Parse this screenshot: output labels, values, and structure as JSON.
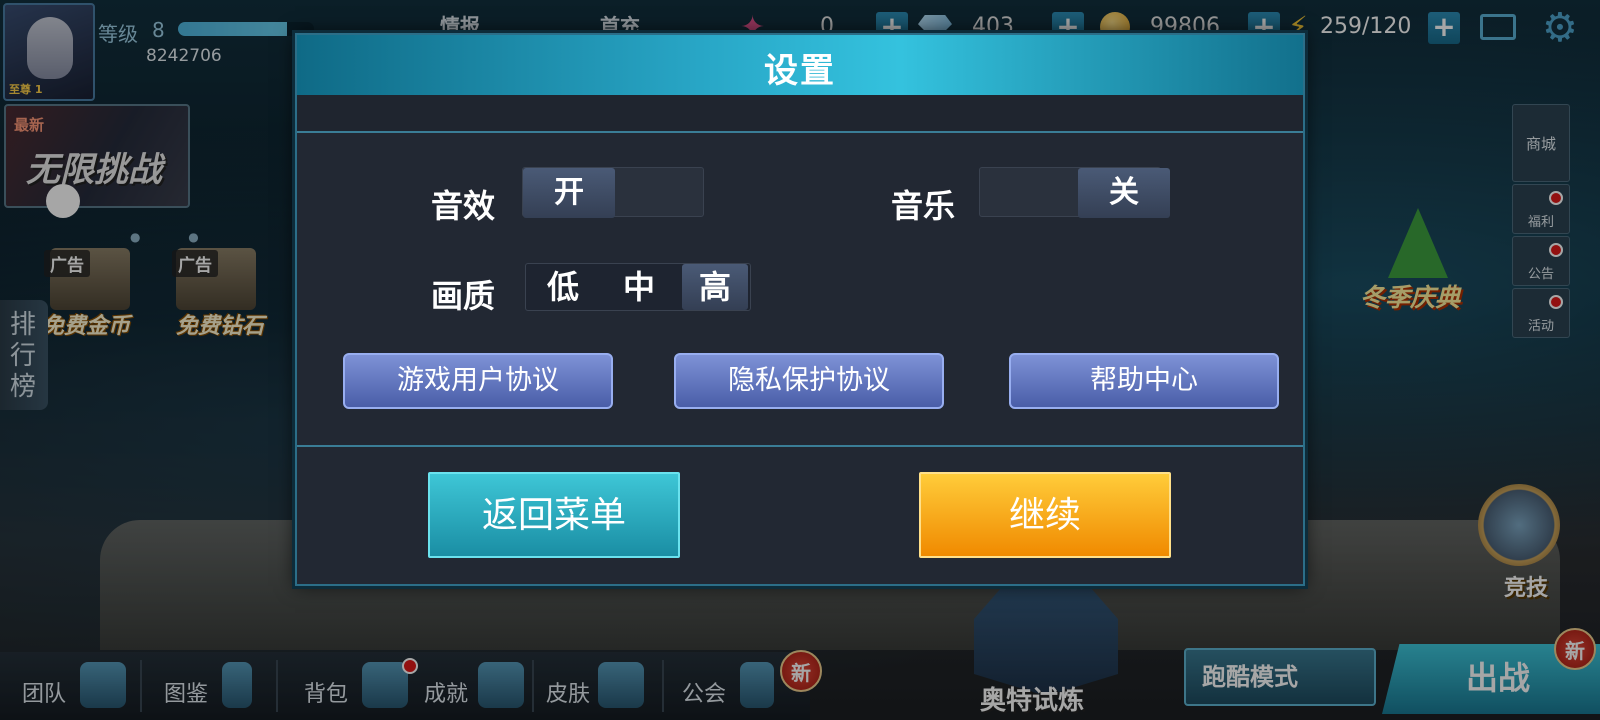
{
  "hud": {
    "level_label": "等级",
    "level_value": "8",
    "exp_fraction": 0.8,
    "player_id": "8242706",
    "rank_badge": "至尊 1",
    "nav_partial_1": "情报",
    "nav_partial_2": "首充",
    "res_star_value": "0",
    "res_diamond_value": "403",
    "res_coin_value": "99806",
    "res_energy_value": "259/120",
    "plus_symbol": "+"
  },
  "left": {
    "challenge_tag": "最新",
    "challenge_title": "无限挑战",
    "ad_tag": "广告",
    "free_gold": "免费金币",
    "free_diamond": "免费钻石",
    "leaderboard": "排行榜"
  },
  "right": {
    "shop": "商城",
    "welfare": "福利",
    "notice": "公告",
    "events": "活动",
    "winter_event": "冬季庆典",
    "arena": "竞技"
  },
  "bottom": {
    "team": "团队",
    "codex": "图鉴",
    "backpack": "背包",
    "achievement": "成就",
    "skin": "皮肤",
    "guild": "公会",
    "new_badge": "新",
    "ultra_trial": "奥特试炼",
    "parkour_mode": "跑酷模式",
    "battle": "出战"
  },
  "dialog": {
    "title": "设置",
    "sound_label": "音效",
    "sound_state": "开",
    "music_label": "音乐",
    "music_state": "关",
    "quality_label": "画质",
    "quality_options": [
      "低",
      "中",
      "高"
    ],
    "quality_selected": "高",
    "user_agreement": "游戏用户协议",
    "privacy_agreement": "隐私保护协议",
    "help_center": "帮助中心",
    "back_to_menu": "返回菜单",
    "continue": "继续"
  },
  "colors": {
    "dialog_header": "#28a6c6",
    "link_button": "#6a7ec8",
    "back_button": "#2bb0c2",
    "continue_button": "#f8a818",
    "notification_red": "#e01a1a"
  }
}
